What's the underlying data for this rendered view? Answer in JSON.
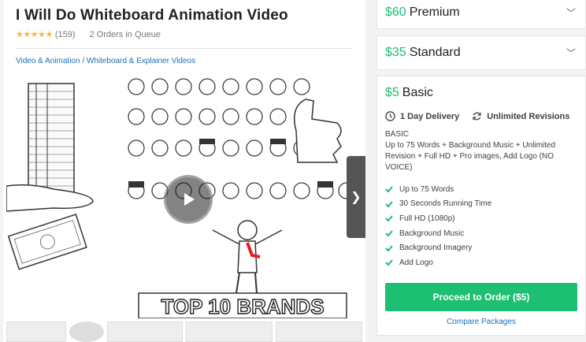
{
  "gig": {
    "title": "I Will Do Whiteboard Animation Video",
    "rating_count": "(159)",
    "queue": "2 Orders in Queue",
    "breadcrumb": "Video & Animation / Whiteboard & Explainer Videos",
    "video_text": "TOP 10 BRANDS"
  },
  "packages": {
    "premium": {
      "price": "$60",
      "name": "Premium"
    },
    "standard": {
      "price": "$35",
      "name": "Standard"
    },
    "basic": {
      "price": "$5",
      "name": "Basic",
      "delivery": "1 Day Delivery",
      "revisions": "Unlimited Revisions",
      "title": "BASIC",
      "description": "Up to 75 Words + Background Music + Unlimited Revision + Full HD + Pro images, Add Logo (NO VOICE)",
      "features": [
        "Up to 75 Words",
        "30 Seconds Running Time",
        "Full HD (1080p)",
        "Background Music",
        "Background Imagery",
        "Add Logo"
      ],
      "order_button": "Proceed to Order ($5)",
      "compare": "Compare Packages"
    }
  },
  "colors": {
    "accent": "#1dbf73",
    "link": "#1b6fb6",
    "star": "#ffb33e"
  }
}
